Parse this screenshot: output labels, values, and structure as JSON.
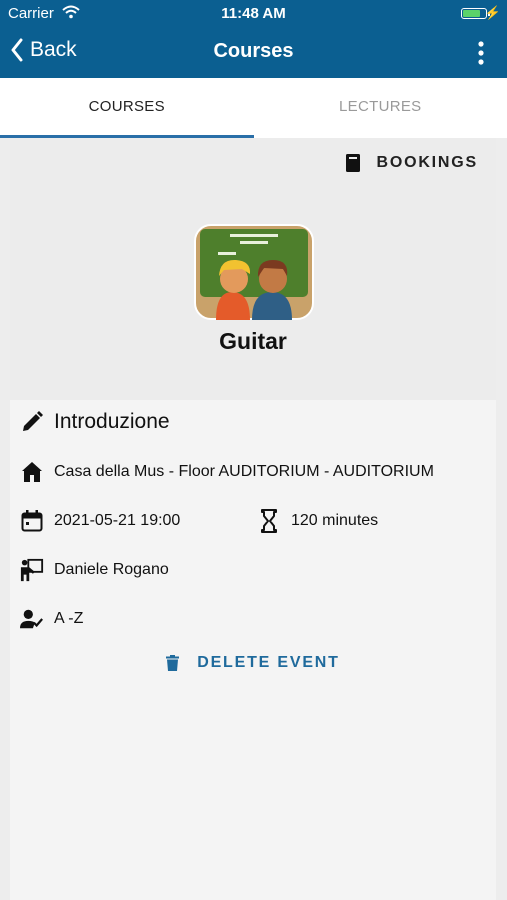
{
  "status": {
    "carrier": "Carrier",
    "time": "11:48 AM"
  },
  "nav": {
    "back_label": "Back",
    "title": "Courses"
  },
  "tabs": [
    {
      "label": "COURSES"
    },
    {
      "label": "LECTURES"
    }
  ],
  "header": {
    "bookings_label": "BOOKINGS",
    "course_name": "Guitar"
  },
  "event": {
    "title": "Introduzione",
    "location": "Casa della Mus - Floor AUDITORIUM - AUDITORIUM",
    "datetime": "2021-05-21 19:00",
    "duration": "120 minutes",
    "teacher": "Daniele Rogano",
    "group": "A -Z",
    "delete_label": "DELETE EVENT"
  },
  "colors": {
    "brand": "#0b5f91",
    "accent": "#2a6fa8",
    "delete": "#1f6a9c"
  },
  "icons": [
    "wifi-icon",
    "battery-icon",
    "chevron-left-icon",
    "more-vertical-icon",
    "book-icon",
    "pencil-icon",
    "home-icon",
    "calendar-icon",
    "hourglass-icon",
    "teacher-icon",
    "user-check-icon",
    "trash-icon"
  ]
}
